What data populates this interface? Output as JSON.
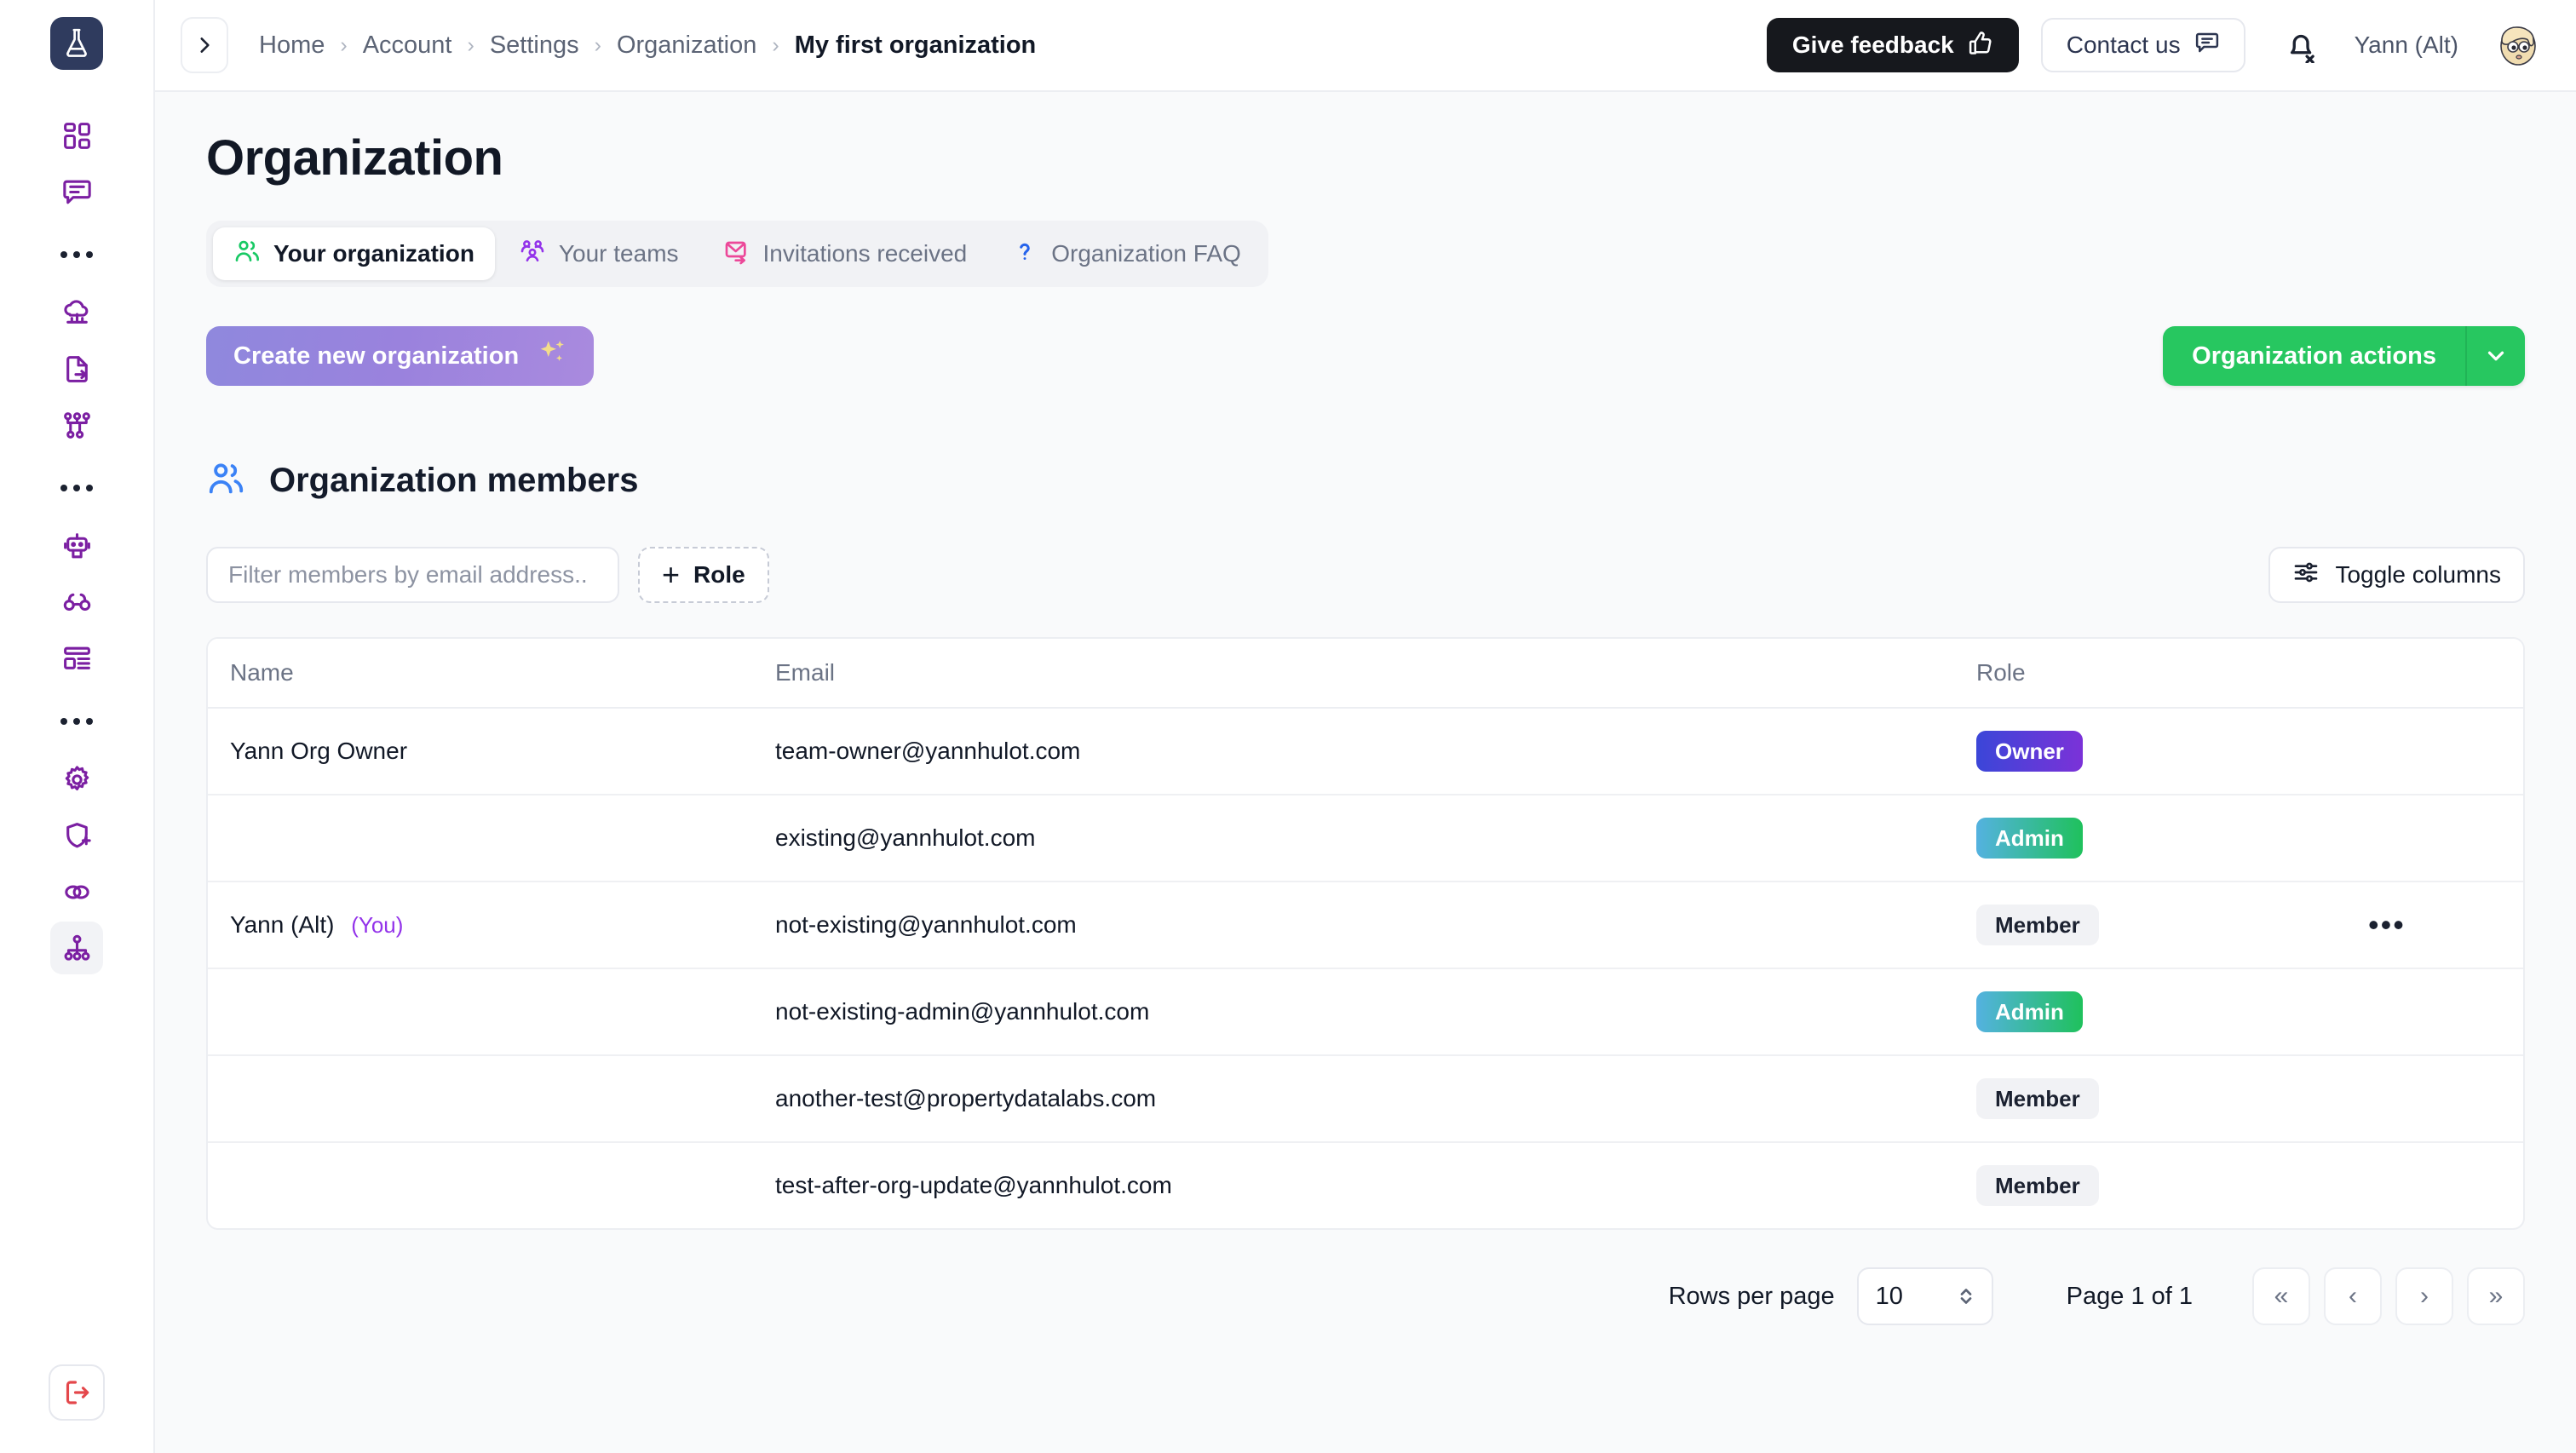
{
  "sidebar": {
    "logo_icon": "flask-logo-icon",
    "items": [
      {
        "icon": "dashboard-grid-icon",
        "active": false
      },
      {
        "icon": "chat-bubble-icon",
        "active": false
      },
      {
        "icon": "ellipsis-icon",
        "active": false
      },
      {
        "icon": "cloud-network-icon",
        "active": false
      },
      {
        "icon": "file-export-icon",
        "active": false
      },
      {
        "icon": "workflow-nodes-icon",
        "active": false
      },
      {
        "icon": "ellipsis-icon",
        "active": false
      },
      {
        "icon": "robot-icon",
        "active": false
      },
      {
        "icon": "glasses-icon",
        "active": false
      },
      {
        "icon": "layout-list-icon",
        "active": false
      },
      {
        "icon": "ellipsis-icon",
        "active": false
      },
      {
        "icon": "gear-icon",
        "active": false
      },
      {
        "icon": "shield-plus-icon",
        "active": false
      },
      {
        "icon": "linked-rings-icon",
        "active": false
      },
      {
        "icon": "org-hierarchy-icon",
        "active": true
      }
    ],
    "logout_icon": "logout-icon"
  },
  "header": {
    "collapse_icon": "chevron-right-icon",
    "breadcrumb": [
      "Home",
      "Account",
      "Settings",
      "Organization",
      "My first organization"
    ],
    "feedback_label": "Give feedback",
    "feedback_icon": "thumbs-up-icon",
    "contact_label": "Contact us",
    "contact_icon": "chat-message-icon",
    "bell_icon": "bell-off-icon",
    "user_name": "Yann (Alt)",
    "avatar_icon": "user-avatar"
  },
  "page": {
    "title": "Organization"
  },
  "tabs": [
    {
      "label": "Your organization",
      "icon": "users-icon",
      "color": "#18c964",
      "active": true
    },
    {
      "label": "Your teams",
      "icon": "team-group-icon",
      "color": "#9333ea",
      "active": false
    },
    {
      "label": "Invitations received",
      "icon": "mail-invite-icon",
      "color": "#ec4899",
      "active": false
    },
    {
      "label": "Organization FAQ",
      "icon": "question-mark-icon",
      "color": "#2563eb",
      "active": false
    }
  ],
  "actions": {
    "create_label": "Create new organization",
    "create_icon": "sparkles-icon",
    "org_actions_label": "Organization actions",
    "org_actions_caret_icon": "chevron-down-icon"
  },
  "members_section": {
    "icon": "members-icon",
    "title": "Organization members",
    "filter_placeholder": "Filter members by email address..",
    "filter_value": "",
    "role_button_label": "Role",
    "role_button_icon": "plus-icon",
    "toggle_columns_label": "Toggle columns",
    "toggle_columns_icon": "sliders-icon"
  },
  "table": {
    "columns": [
      "Name",
      "Email",
      "Role",
      ""
    ],
    "rows": [
      {
        "name": "Yann Org Owner",
        "you": "",
        "email": "team-owner@yannhulot.com",
        "role": "Owner",
        "role_style": "owner",
        "menu": ""
      },
      {
        "name": "",
        "you": "",
        "email": "existing@yannhulot.com",
        "role": "Admin",
        "role_style": "admin",
        "menu": ""
      },
      {
        "name": "Yann (Alt)",
        "you": "(You)",
        "email": "not-existing@yannhulot.com",
        "role": "Member",
        "role_style": "member",
        "menu": "•••"
      },
      {
        "name": "",
        "you": "",
        "email": "not-existing-admin@yannhulot.com",
        "role": "Admin",
        "role_style": "admin",
        "menu": ""
      },
      {
        "name": "",
        "you": "",
        "email": "another-test@propertydatalabs.com",
        "role": "Member",
        "role_style": "member",
        "menu": ""
      },
      {
        "name": "",
        "you": "",
        "email": "test-after-org-update@yannhulot.com",
        "role": "Member",
        "role_style": "member",
        "menu": ""
      }
    ]
  },
  "pagination": {
    "rows_per_page_label": "Rows per page",
    "rows_per_page_value": "10",
    "page_label": "Page 1 of 1",
    "first_icon": "«",
    "prev_icon": "‹",
    "next_icon": "›",
    "last_icon": "»"
  },
  "colors": {
    "accent_green": "#27c760",
    "accent_purple": "#9333ea",
    "owner_badge": "#3b46d8",
    "admin_badge": "#1fc15c",
    "logout_red": "#e4474b",
    "sidebar_icon": "#7b1fa2"
  }
}
